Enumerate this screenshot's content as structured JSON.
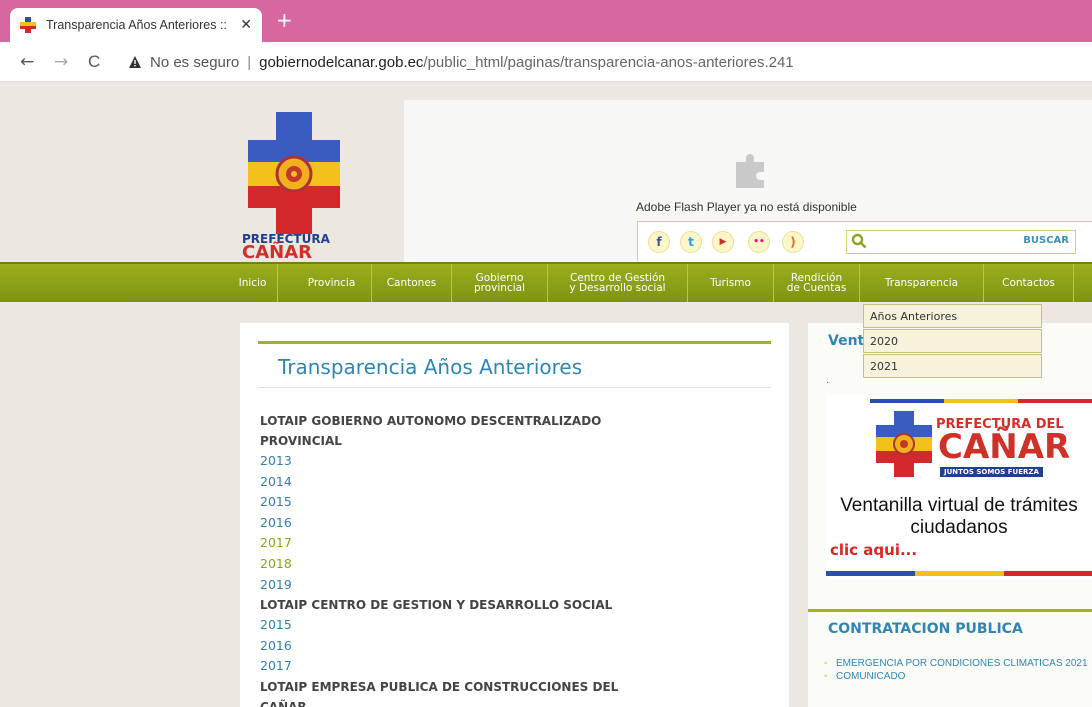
{
  "browser": {
    "tab_title": "Transparencia Años Anteriores :: ",
    "tab_close": "✕",
    "new_tab": "+",
    "nav": {
      "back": "←",
      "forward": "→",
      "reload": "C"
    },
    "security_label": "No es seguro",
    "url_host": "gobiernodelcanar.gob.ec",
    "url_path": "/public_html/paginas/transparencia-anos-anteriores.241"
  },
  "header": {
    "flash_message": "Adobe Flash Player ya no está disponible",
    "logo_text": {
      "line1": "PREFECTURA",
      "line2": "CAÑAR",
      "tagline": "JUNTOS SOMOS FUERZA"
    },
    "social": [
      {
        "icon": "facebook-icon",
        "glyph": "f",
        "color": "#3b5998"
      },
      {
        "icon": "twitter-icon",
        "glyph": "t",
        "color": "#1da1f2"
      },
      {
        "icon": "youtube-icon",
        "glyph": "▶",
        "color": "#c4302b"
      },
      {
        "icon": "flickr-icon",
        "glyph": "••",
        "color": "#ff0084"
      },
      {
        "icon": "rss-icon",
        "glyph": ")",
        "color": "#f26522"
      }
    ],
    "search_placeholder": "",
    "search_button": "BUSCAR"
  },
  "menu": [
    {
      "label": "Inicio"
    },
    {
      "label": "Provincia"
    },
    {
      "label": "Cantones"
    },
    {
      "label": "Gobierno\nprovincial"
    },
    {
      "label": "Centro de Gestión\ny Desarrollo social"
    },
    {
      "label": "Turismo"
    },
    {
      "label": "Rendición\nde Cuentas"
    },
    {
      "label": "Transparencia"
    },
    {
      "label": "Contactos"
    }
  ],
  "dropdown": [
    "Años Anteriores",
    "2020",
    "2021"
  ],
  "main": {
    "title": "Transparencia Años Anteriores",
    "sections": [
      {
        "heading": "LOTAIP GOBIERNO AUTONOMO DESCENTRALIZADO PROVINCIAL",
        "years": [
          "2013",
          "2014",
          "2015",
          "2016",
          "2017",
          "2018",
          "2019"
        ]
      },
      {
        "heading": "LOTAIP CENTRO DE GESTION Y DESARROLLO SOCIAL",
        "years": [
          "2015",
          "2016",
          "2017"
        ]
      },
      {
        "heading": "LOTAIP EMPRESA PUBLICA DE CONSTRUCCIONES DEL CAÑAR",
        "years": []
      }
    ]
  },
  "sidebar": {
    "ventanilla_title": "Venta",
    "dot": ".",
    "banner": {
      "word1": "PREFECTURA DEL",
      "word2": "CAÑAR",
      "word3": "JUNTOS SOMOS FUERZA",
      "text": "Ventanilla virtual de trámites ciudadanos",
      "cta": "clic aqui..."
    },
    "contratacion_title": "CONTRATACION PUBLICA",
    "contratacion_items": [
      "EMERGENCIA POR CONDICIONES CLIMATICAS 2021",
      "COMUNICADO"
    ]
  },
  "colors": {
    "menu_green": "#8fa31a",
    "link_blue": "#2f86b5",
    "accent_red": "#d7261e",
    "tab_bar_pink": "#d6679f"
  }
}
